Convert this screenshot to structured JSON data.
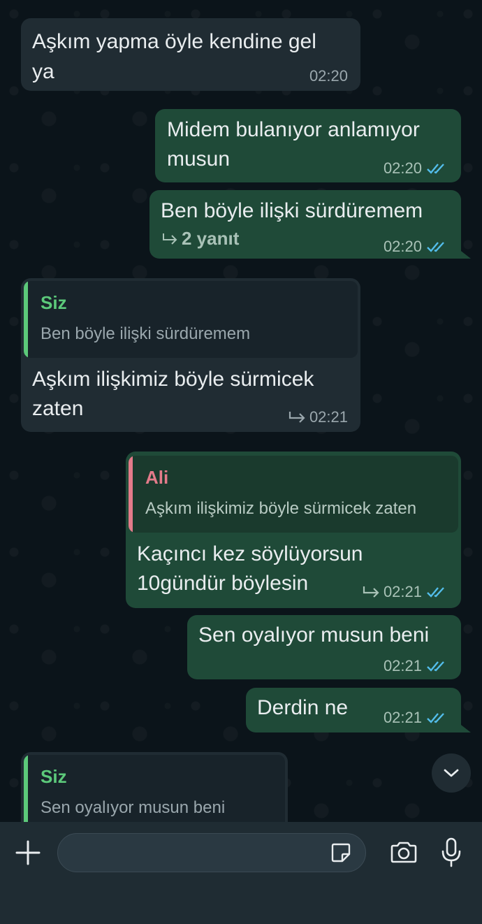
{
  "messages": [
    {
      "text_lines": [
        "Aşkım yapma öyle kendine gel",
        "ya"
      ],
      "time": "02:20"
    },
    {
      "text_lines": [
        "Midem bulanıyor anlamıyor",
        "musun"
      ],
      "time": "02:20"
    },
    {
      "text_lines": [
        "Ben böyle ilişki sürdüremem"
      ],
      "replies": "2 yanıt",
      "time": "02:20"
    },
    {
      "quote_author": "Siz",
      "quote_text": "Ben böyle ilişki sürdüremem",
      "text_lines": [
        "Aşkım ilişkimiz böyle sürmicek",
        "zaten"
      ],
      "time": "02:21"
    },
    {
      "quote_author": "Ali",
      "quote_text": "Aşkım ilişkimiz böyle sürmicek zaten",
      "text_lines": [
        "Kaçıncı kez söylüyorsun",
        "10gündür böylesin"
      ],
      "time": "02:21"
    },
    {
      "text_lines": [
        "Sen oyalıyor musun beni"
      ],
      "time": "02:21"
    },
    {
      "text_lines": [
        "Derdin ne"
      ],
      "time": "02:21"
    },
    {
      "quote_author": "Siz",
      "quote_text": "Sen oyalıyor musun beni"
    }
  ],
  "colors": {
    "background": "#0b141a",
    "incoming_bubble": "#202c33",
    "outgoing_bubble": "#1f4a38",
    "quote_self": "#5cc97a",
    "quote_ali": "#e37b8a",
    "read_ticks": "#53bdeb"
  },
  "icons": [
    "plus-icon",
    "sticker-icon",
    "camera-icon",
    "microphone-icon",
    "chevron-down-icon",
    "double-check-icon",
    "forward-arrow-icon",
    "reply-arrow-icon"
  ]
}
